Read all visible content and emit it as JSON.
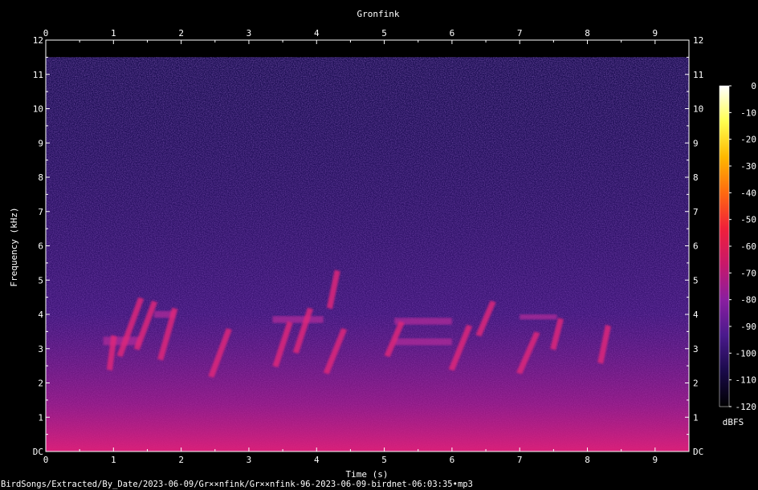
{
  "chart_data": {
    "type": "heatmap",
    "title": "Gronfink",
    "xlabel": "Time (s)",
    "ylabel": "Frequency (kHz)",
    "xlim": [
      0,
      9.5
    ],
    "ylim": [
      0,
      12
    ],
    "x_ticks": [
      "0",
      "1",
      "2",
      "3",
      "4",
      "5",
      "6",
      "7",
      "8",
      "9"
    ],
    "y_ticks": [
      "DC",
      "1",
      "2",
      "3",
      "4",
      "5",
      "6",
      "7",
      "8",
      "9",
      "10",
      "11",
      "12"
    ],
    "colorbar": {
      "label": "dBFS",
      "range": [
        -120,
        0
      ],
      "ticks": [
        "0",
        "-10",
        "-20",
        "-30",
        "-40",
        "-50",
        "-60",
        "-70",
        "-80",
        "-90",
        "-100",
        "-110",
        "-120"
      ],
      "colors": [
        "#000000",
        "#1a0a4a",
        "#4a1a8c",
        "#8a1ea0",
        "#c8186a",
        "#f0203a",
        "#ff6a10",
        "#ffb800",
        "#ffff50",
        "#ffffff"
      ]
    },
    "noise_top_khz": 11.5,
    "calls": [
      {
        "t0": 0.9,
        "t1": 1.05,
        "f0": 2.4,
        "f1": 3.4
      },
      {
        "t0": 1.05,
        "t1": 1.45,
        "f0": 2.8,
        "f1": 4.5
      },
      {
        "t0": 1.3,
        "t1": 1.65,
        "f0": 3.0,
        "f1": 4.4
      },
      {
        "t0": 1.65,
        "t1": 1.95,
        "f0": 2.7,
        "f1": 4.2
      },
      {
        "t0": 2.4,
        "t1": 2.75,
        "f0": 2.2,
        "f1": 3.6
      },
      {
        "t0": 3.35,
        "t1": 3.65,
        "f0": 2.5,
        "f1": 3.8
      },
      {
        "t0": 3.65,
        "t1": 3.95,
        "f0": 2.9,
        "f1": 4.2
      },
      {
        "t0": 4.1,
        "t1": 4.45,
        "f0": 2.3,
        "f1": 3.6
      },
      {
        "t0": 4.15,
        "t1": 4.35,
        "f0": 4.2,
        "f1": 5.3
      },
      {
        "t0": 5.0,
        "t1": 5.3,
        "f0": 2.8,
        "f1": 3.8
      },
      {
        "t0": 5.95,
        "t1": 6.3,
        "f0": 2.4,
        "f1": 3.7
      },
      {
        "t0": 6.35,
        "t1": 6.65,
        "f0": 3.4,
        "f1": 4.4
      },
      {
        "t0": 6.95,
        "t1": 7.3,
        "f0": 2.3,
        "f1": 3.5
      },
      {
        "t0": 7.45,
        "t1": 7.65,
        "f0": 3.0,
        "f1": 3.9
      },
      {
        "t0": 8.15,
        "t1": 8.35,
        "f0": 2.6,
        "f1": 3.7
      }
    ],
    "bands": [
      {
        "t0": 0.85,
        "t1": 1.4,
        "f0": 3.1,
        "f1": 3.35
      },
      {
        "t0": 1.6,
        "t1": 1.9,
        "f0": 3.9,
        "f1": 4.1
      },
      {
        "t0": 3.35,
        "t1": 4.1,
        "f0": 3.75,
        "f1": 3.95
      },
      {
        "t0": 5.15,
        "t1": 6.0,
        "f0": 3.1,
        "f1": 3.3
      },
      {
        "t0": 5.15,
        "t1": 6.0,
        "f0": 3.7,
        "f1": 3.9
      },
      {
        "t0": 7.0,
        "t1": 7.55,
        "f0": 3.85,
        "f1": 4.0
      }
    ]
  },
  "footer_path": "BirdSongs/Extracted/By_Date/2023-06-09/Gr××nfink/Gr××nfink-96-2023-06-09-birdnet-06:03:35•mp3"
}
